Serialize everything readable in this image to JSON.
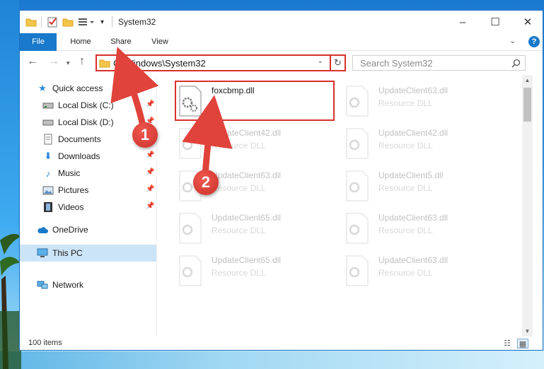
{
  "window": {
    "title": "System32"
  },
  "ribbon": {
    "tabs": [
      "File",
      "Home",
      "Share",
      "View"
    ],
    "help": "?"
  },
  "navigation": {
    "address": "C:\\Windows\\System32",
    "search_placeholder": "Search System32"
  },
  "sidebar": {
    "items": [
      {
        "label": "Quick access",
        "icon": "star-icon",
        "pinned": false
      },
      {
        "label": "Local Disk (C:)",
        "icon": "drive-icon",
        "pinned": true
      },
      {
        "label": "Local Disk (D:)",
        "icon": "drive-icon",
        "pinned": true
      },
      {
        "label": "Documents",
        "icon": "documents-icon",
        "pinned": true
      },
      {
        "label": "Downloads",
        "icon": "download-icon",
        "pinned": true
      },
      {
        "label": "Music",
        "icon": "music-icon",
        "pinned": true
      },
      {
        "label": "Pictures",
        "icon": "pictures-icon",
        "pinned": true
      },
      {
        "label": "Videos",
        "icon": "videos-icon",
        "pinned": true
      },
      {
        "label": "OneDrive",
        "icon": "cloud-icon",
        "pinned": false
      },
      {
        "label": "This PC",
        "icon": "pc-icon",
        "pinned": false,
        "selected": true
      },
      {
        "label": "Network",
        "icon": "network-icon",
        "pinned": false
      }
    ]
  },
  "files": [
    {
      "name": "foxcbmp.dll",
      "type": "",
      "highlighted": true
    },
    {
      "name": "UpdateClient63.dll",
      "type": "Resource DLL"
    },
    {
      "name": "UpdateClient42.dll",
      "type": "Resource DLL"
    },
    {
      "name": "UpdateClient42.dll",
      "type": "Resource DLL"
    },
    {
      "name": "UpdateClient63.dll",
      "type": "Resource DLL"
    },
    {
      "name": "UpdateClient5.dll",
      "type": "Resource DLL"
    },
    {
      "name": "UpdateClient65.dll",
      "type": "Resource DLL"
    },
    {
      "name": "UpdateClient63.dll",
      "type": "Resource DLL"
    },
    {
      "name": "UpdateClient65.dll",
      "type": "Resource DLL"
    },
    {
      "name": "UpdateClient63.dll",
      "type": "Resource DLL"
    }
  ],
  "status": {
    "item_count": "100 items"
  },
  "callouts": {
    "step1": "1",
    "step2": "2"
  },
  "colors": {
    "accent": "#1979ca",
    "highlight": "#d9302a",
    "selected": "#cce4f7"
  }
}
